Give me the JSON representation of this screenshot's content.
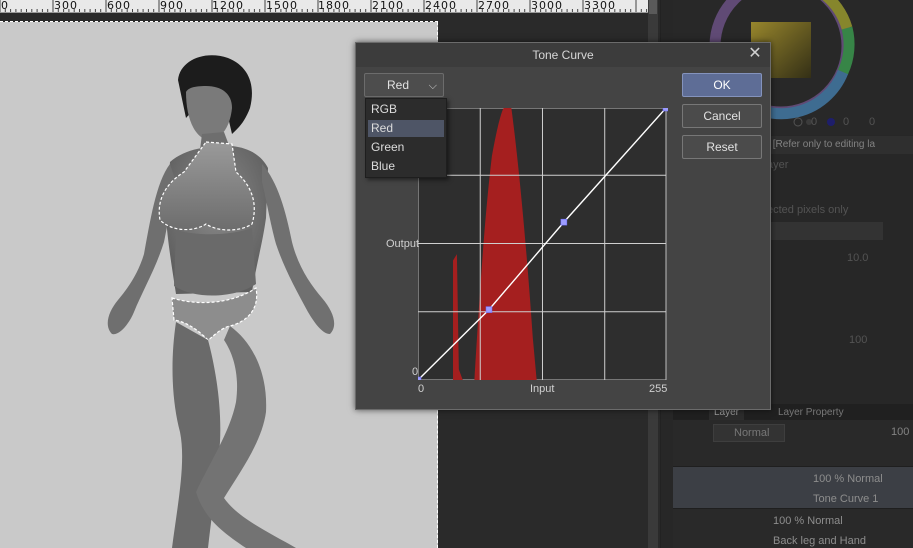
{
  "ruler": {
    "labels": [
      "0",
      "300",
      "600",
      "900",
      "1200",
      "1500",
      "1800",
      "2100",
      "2400",
      "2700",
      "3000",
      "3300"
    ]
  },
  "dialog": {
    "title": "Tone Curve",
    "channel": {
      "selected": "Red",
      "options": [
        "RGB",
        "Red",
        "Green",
        "Blue"
      ]
    },
    "buttons": {
      "ok": "OK",
      "cancel": "Cancel",
      "reset": "Reset"
    },
    "axes": {
      "output_label": "Output",
      "input_label": "Input",
      "min": "0",
      "max": "255",
      "y_min": "0"
    },
    "curve_points": [
      [
        0,
        0
      ],
      [
        73,
        66
      ],
      [
        150,
        148
      ],
      [
        255,
        255
      ]
    ],
    "histogram_color": "#a51f1f"
  },
  "right_panel": {
    "color_values": [
      "0",
      "0",
      "0"
    ],
    "property_text": "y [Refer only to editing la",
    "layer_text": "ayer",
    "selected_pixels_text": "ected pixels only",
    "value_1": "10.0",
    "value_2": "100",
    "tabs": {
      "layer": "Layer",
      "property": "Layer Property"
    },
    "blend_mode": "Normal",
    "opacity": "100",
    "layers": [
      {
        "opacity_mode": "100 % Normal",
        "name": "Tone Curve 1"
      },
      {
        "opacity_mode": "100 % Normal",
        "name": "Back leg and Hand"
      }
    ]
  },
  "colors": {
    "accent": "#5e6d96",
    "menu_selection": "#4e5566",
    "curve_point": "#9c9cff"
  }
}
